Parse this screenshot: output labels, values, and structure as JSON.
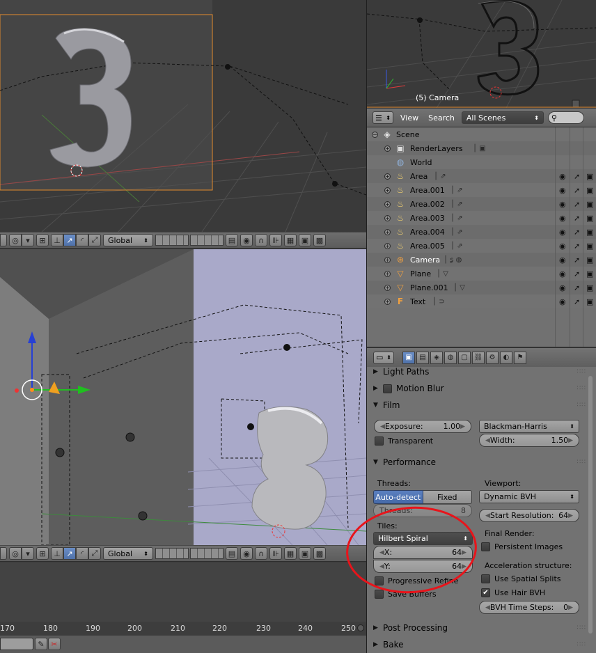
{
  "viewport_top": {
    "header": {
      "orientation": "Global"
    }
  },
  "viewport_bottom": {
    "header": {
      "orientation": "Global"
    }
  },
  "camera_view": {
    "label": "(5) Camera"
  },
  "timeline": {
    "ticks": [
      "170",
      "180",
      "190",
      "200",
      "210",
      "220",
      "230",
      "240",
      "250"
    ]
  },
  "outliner": {
    "menu_view": "View",
    "menu_search": "Search",
    "scenes_select": "All Scenes",
    "rows": [
      {
        "name": "Scene",
        "icon": "scene-icon"
      },
      {
        "name": "RenderLayers",
        "icon": "render-layers-icon"
      },
      {
        "name": "World",
        "icon": "world-icon"
      },
      {
        "name": "Area",
        "icon": "lamp-icon"
      },
      {
        "name": "Area.001",
        "icon": "lamp-icon"
      },
      {
        "name": "Area.002",
        "icon": "lamp-icon"
      },
      {
        "name": "Area.003",
        "icon": "lamp-icon"
      },
      {
        "name": "Area.004",
        "icon": "lamp-icon"
      },
      {
        "name": "Area.005",
        "icon": "lamp-icon"
      },
      {
        "name": "Camera",
        "icon": "camera-icon"
      },
      {
        "name": "Plane",
        "icon": "mesh-icon"
      },
      {
        "name": "Plane.001",
        "icon": "mesh-icon"
      },
      {
        "name": "Text",
        "icon": "text-icon"
      }
    ]
  },
  "properties": {
    "light_paths": "Light Paths",
    "motion_blur": "Motion Blur",
    "film": {
      "title": "Film",
      "exposure_label": "Exposure:",
      "exposure_value": "1.00",
      "filter": "Blackman-Harris",
      "transparent": "Transparent",
      "width_label": "Width:",
      "width_value": "1.50"
    },
    "performance": {
      "title": "Performance",
      "threads_label": "Threads:",
      "auto_detect": "Auto-detect",
      "fixed": "Fixed",
      "threads_field": "Threads:",
      "threads_value": "8",
      "tiles_label": "Tiles:",
      "tile_order": "Hilbert Spiral",
      "x_label": "X:",
      "x_value": "64",
      "y_label": "Y:",
      "y_value": "64",
      "progressive_refine": "Progressive Refine",
      "save_buffers": "Save Buffers",
      "viewport_label": "Viewport:",
      "viewport_bvh": "Dynamic BVH",
      "start_res_label": "Start Resolution:",
      "start_res_value": "64",
      "final_render_label": "Final Render:",
      "persistent_images": "Persistent Images",
      "accel_label": "Acceleration structure:",
      "use_spatial_splits": "Use Spatial Splits",
      "use_hair_bvh": "Use Hair BVH",
      "bvh_steps_label": "BVH Time Steps:",
      "bvh_steps_value": "0"
    },
    "post_processing": "Post Processing",
    "bake": "Bake"
  }
}
